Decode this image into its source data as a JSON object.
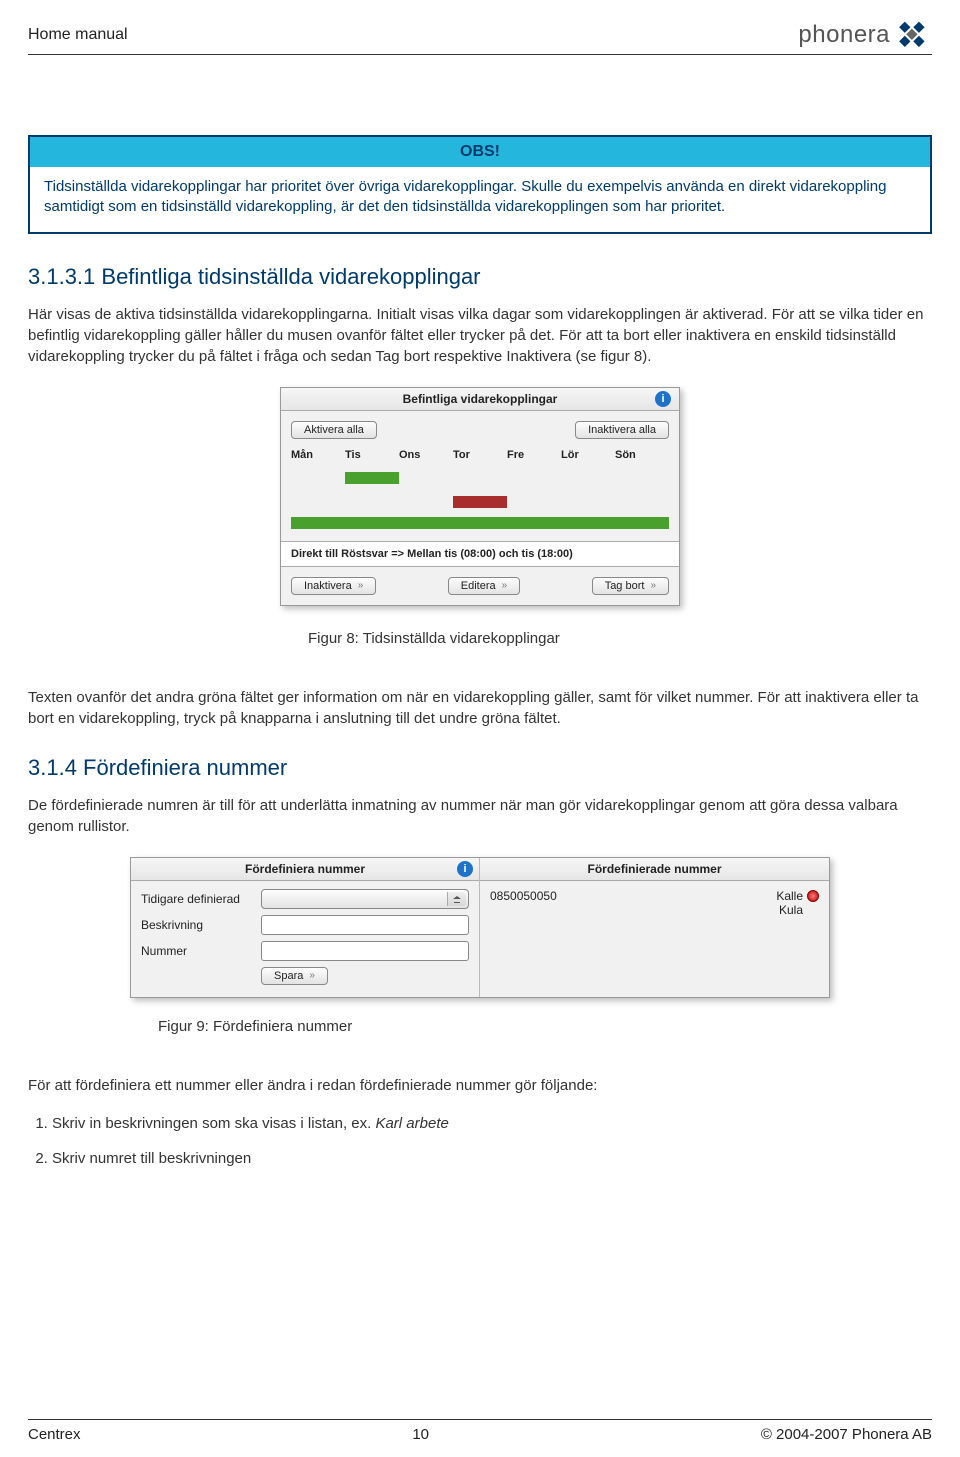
{
  "header": {
    "title": "Home manual",
    "brand": "phonera"
  },
  "callout": {
    "head": "OBS!",
    "body": "Tidsinställda vidarekopplingar har prioritet över övriga vidarekopplingar. Skulle du exempelvis använda en direkt vidarekoppling samtidigt som en tidsinställd vidarekoppling, är det den tidsinställda vidarekopplingen som har prioritet."
  },
  "sec3131": {
    "heading": "3.1.3.1 Befintliga tidsinställda vidarekopplingar",
    "p": "Här visas de aktiva tidsinställda vidarekopplingarna. Initialt visas vilka dagar som vidarekopplingen är aktiverad. För att se vilka tider en befintlig vidarekoppling gäller håller du musen ovanför fältet eller trycker på det. För att ta bort eller inaktivera en enskild tidsinställd vidarekoppling trycker du på fältet i fråga och sedan Tag bort respektive Inaktivera (se figur 8)."
  },
  "fig8": {
    "title": "Befintliga vidarekopplingar",
    "activate_all": "Aktivera alla",
    "deactivate_all": "Inaktivera alla",
    "days": [
      "Mån",
      "Tis",
      "Ons",
      "Tor",
      "Fre",
      "Lör",
      "Sön"
    ],
    "detail": "Direkt till Röstsvar => Mellan tis (08:00) och tis (18:00)",
    "inactivate": "Inaktivera",
    "edit": "Editera",
    "delete": "Tag bort",
    "caption": "Figur 8: Tidsinställda vidarekopplingar"
  },
  "mid_p": "Texten ovanför det andra gröna fältet ger information om när en vidarekoppling gäller, samt för vilket nummer. För att inaktivera eller ta bort en vidarekoppling, tryck på knapparna i anslutning till det undre gröna fältet.",
  "sec314": {
    "heading": "3.1.4 Fördefiniera nummer",
    "p": "De fördefinierade numren är till för att underlätta inmatning av nummer när man gör vidarekopplingar genom att göra dessa valbara genom rullistor."
  },
  "fig9": {
    "left_title": "Fördefiniera nummer",
    "right_title": "Fördefinierade nummer",
    "lbl_prev": "Tidigare definierad",
    "lbl_desc": "Beskrivning",
    "lbl_num": "Nummer",
    "save": "Spara",
    "list_number": "0850050050",
    "list_name": "Kalle Kula",
    "caption": "Figur 9: Fördefiniera nummer"
  },
  "tail": {
    "intro": "För att fördefiniera ett nummer eller ändra i redan fördefinierade nummer gör följande:",
    "step1a": "Skriv in beskrivningen som ska visas i listan, ex. ",
    "step1b": "Karl arbete",
    "step2": "Skriv numret till beskrivningen"
  },
  "footer": {
    "left": "Centrex",
    "page": "10",
    "right": "© 2004-2007 Phonera AB"
  }
}
